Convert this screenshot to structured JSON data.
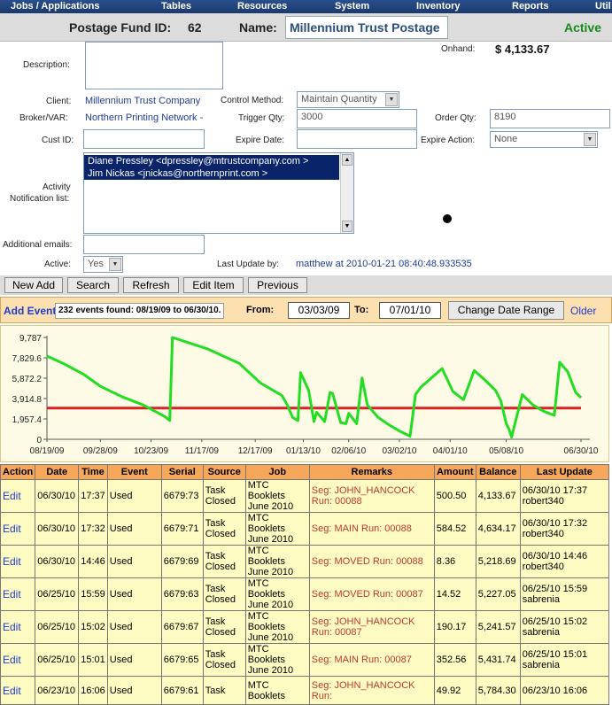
{
  "menu": [
    "Jobs / Applications",
    "Tables",
    "Resources",
    "System",
    "Inventory",
    "Reports",
    "Util"
  ],
  "header": {
    "fund_id_label": "Postage Fund ID:",
    "fund_id": "62",
    "name_label": "Name:",
    "name_value": "Millennium Trust Postage",
    "status": "Active"
  },
  "form": {
    "onhand_label": "Onhand:",
    "onhand_value": "$ 4,133.67",
    "description_label": "Description:",
    "description_value": "",
    "client_label": "Client:",
    "client_value": "Millennium Trust Company",
    "control_method_label": "Control Method:",
    "control_method_value": "Maintain Quantity",
    "broker_label": "Broker/VAR:",
    "broker_value": "Northern Printing Network -",
    "trigger_qty_label": "Trigger Qty:",
    "trigger_qty_value": "3000",
    "order_qty_label": "Order Qty:",
    "order_qty_value": "8190",
    "cust_id_label": "Cust ID:",
    "cust_id_value": "",
    "expire_date_label": "Expire Date:",
    "expire_date_value": "",
    "expire_action_label": "Expire Action:",
    "expire_action_value": "None",
    "activity_label_1": "Activity",
    "activity_label_2": "Notification list:",
    "activity_list": [
      "Diane Pressley <dpressley@mtrustcompany.com >",
      "Jim Nickas <jnickas@northernprint.com >"
    ],
    "additional_emails_label": "Additional emails:",
    "additional_emails_value": "",
    "active_label": "Active:",
    "active_value": "Yes",
    "last_update_label": "Last Update by:",
    "last_update_value": "matthew at 2010-01-21 08:40:48.933535"
  },
  "buttons": {
    "new_add": "New Add",
    "search": "Search",
    "refresh": "Refresh",
    "edit_item": "Edit Item",
    "previous": "Previous"
  },
  "events": {
    "add_event": "Add Event",
    "count_text": "232 events found: 08/19/09 to 06/30/10.",
    "from_label": "From:",
    "from_value": "03/03/09",
    "to_label": "To:",
    "to_value": "07/01/10",
    "change_range": "Change Date Range",
    "older": "Older"
  },
  "chart_data": {
    "type": "line",
    "y_ticks": [
      "9,787",
      "7,829.6",
      "5,872.2",
      "3,914.8",
      "1,957.4",
      "0"
    ],
    "ylim": [
      0,
      9787
    ],
    "x_ticks": [
      "08/19/09",
      "09/28/09",
      "10/23/09",
      "11/17/09",
      "12/17/09",
      "01/13/10",
      "02/06/10",
      "03/02/10",
      "04/01/10",
      "05/08/10",
      "06/30/10"
    ],
    "series": [
      {
        "color": "#22dd22",
        "x": [
          0.0,
          0.03,
          0.07,
          0.1,
          0.14,
          0.18,
          0.22,
          0.23,
          0.235,
          0.3,
          0.33,
          0.36,
          0.4,
          0.44,
          0.45,
          0.46,
          0.47,
          0.475,
          0.49,
          0.5,
          0.505,
          0.52,
          0.53,
          0.535,
          0.55,
          0.56,
          0.565,
          0.58,
          0.59,
          0.6,
          0.62,
          0.64,
          0.66,
          0.68,
          0.69,
          0.7,
          0.74,
          0.76,
          0.78,
          0.8,
          0.82,
          0.84,
          0.85,
          0.86,
          0.865,
          0.87,
          0.89,
          0.91,
          0.93,
          0.95,
          0.96,
          0.975,
          0.99,
          1.0
        ],
        "y": [
          8000,
          7300,
          6200,
          5100,
          4100,
          3300,
          2200,
          1800,
          9787,
          8700,
          8000,
          7300,
          5400,
          4200,
          3300,
          2100,
          1800,
          6400,
          4700,
          1700,
          2600,
          1700,
          4500,
          4400,
          1600,
          1500,
          2500,
          1500,
          5900,
          3300,
          2100,
          1400,
          800,
          300,
          4300,
          5000,
          6800,
          4600,
          3800,
          6600,
          5700,
          4700,
          3700,
          1500,
          1000,
          200,
          4300,
          3300,
          2700,
          2300,
          7400,
          6500,
          4500,
          4000
        ]
      }
    ],
    "threshold": 3000,
    "threshold_color": "#dd2020"
  },
  "table": {
    "headers": [
      "Action",
      "Date",
      "Time",
      "Event",
      "Serial",
      "Source",
      "Job",
      "Remarks",
      "Amount",
      "Balance",
      "Last Update"
    ],
    "rows": [
      [
        "Edit",
        "06/30/10",
        "17:37",
        "Used",
        "6679:73",
        "Task Closed",
        "MTC Booklets June 2010",
        "Seg: JOHN_HANCOCK Run: 00088",
        "500.50",
        "4,133.67",
        "06/30/10 17:37 robert340"
      ],
      [
        "Edit",
        "06/30/10",
        "17:32",
        "Used",
        "6679:71",
        "Task Closed",
        "MTC Booklets June 2010",
        "Seg: MAIN Run: 00088",
        "584.52",
        "4,634.17",
        "06/30/10 17:32 robert340"
      ],
      [
        "Edit",
        "06/30/10",
        "14:46",
        "Used",
        "6679:69",
        "Task Closed",
        "MTC Booklets June 2010",
        "Seg: MOVED Run: 00088",
        "8.36",
        "5,218.69",
        "06/30/10 14:46 robert340"
      ],
      [
        "Edit",
        "06/25/10",
        "15:59",
        "Used",
        "6679:63",
        "Task Closed",
        "MTC Booklets June 2010",
        "Seg: MOVED Run: 00087",
        "14.52",
        "5,227.05",
        "06/25/10 15:59 sabrenia"
      ],
      [
        "Edit",
        "06/25/10",
        "15:02",
        "Used",
        "6679:67",
        "Task Closed",
        "MTC Booklets June 2010",
        "Seg: JOHN_HANCOCK Run: 00087",
        "190.17",
        "5,241.57",
        "06/25/10 15:02 sabrenia"
      ],
      [
        "Edit",
        "06/25/10",
        "15:01",
        "Used",
        "6679:65",
        "Task Closed",
        "MTC Booklets June 2010",
        "Seg: MAIN Run: 00087",
        "352.56",
        "5,431.74",
        "06/25/10 15:01 sabrenia"
      ],
      [
        "Edit",
        "06/23/10",
        "16:06",
        "Used",
        "6679:61",
        "Task",
        "MTC Booklets",
        "Seg: JOHN_HANCOCK Run:",
        "49.92",
        "5,784.30",
        "06/23/10 16:06"
      ]
    ]
  }
}
